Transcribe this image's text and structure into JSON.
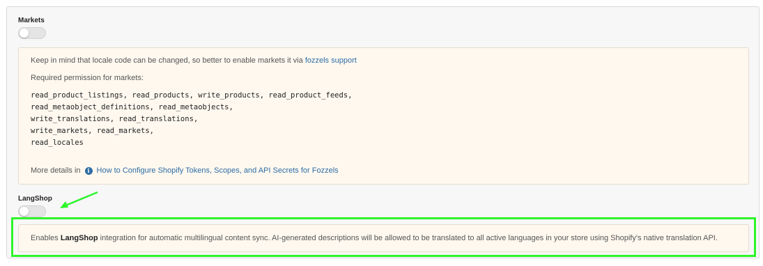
{
  "markets": {
    "label": "Markets",
    "toggle_enabled": false,
    "notice": {
      "line1_text": "Keep in mind that locale code can be changed, so better to enable markets it via ",
      "line1_link": "fozzels support",
      "required_label": "Required permission for markets:",
      "permissions": [
        "read_product_listings, read_products, write_products, read_product_feeds,",
        "read_metaobject_definitions, read_metaobjects,",
        "write_translations, read_translations,",
        "write_markets, read_markets,",
        "read_locales"
      ],
      "more_prefix": "More details in",
      "more_icon": "info-icon",
      "more_link": "How to Configure Shopify Tokens, Scopes, and API Secrets for Fozzels"
    }
  },
  "langshop": {
    "label": "LangShop",
    "toggle_enabled": false,
    "description_prefix": "Enables ",
    "description_bold": "LangShop",
    "description_suffix": " integration for automatic multilingual content sync. AI-generated descriptions will be allowed to be translated to all active languages in your store using Shopify's native translation API."
  },
  "annotation": {
    "highlight_color": "#2df52a",
    "arrow_icon": "arrow-annotation-icon"
  }
}
